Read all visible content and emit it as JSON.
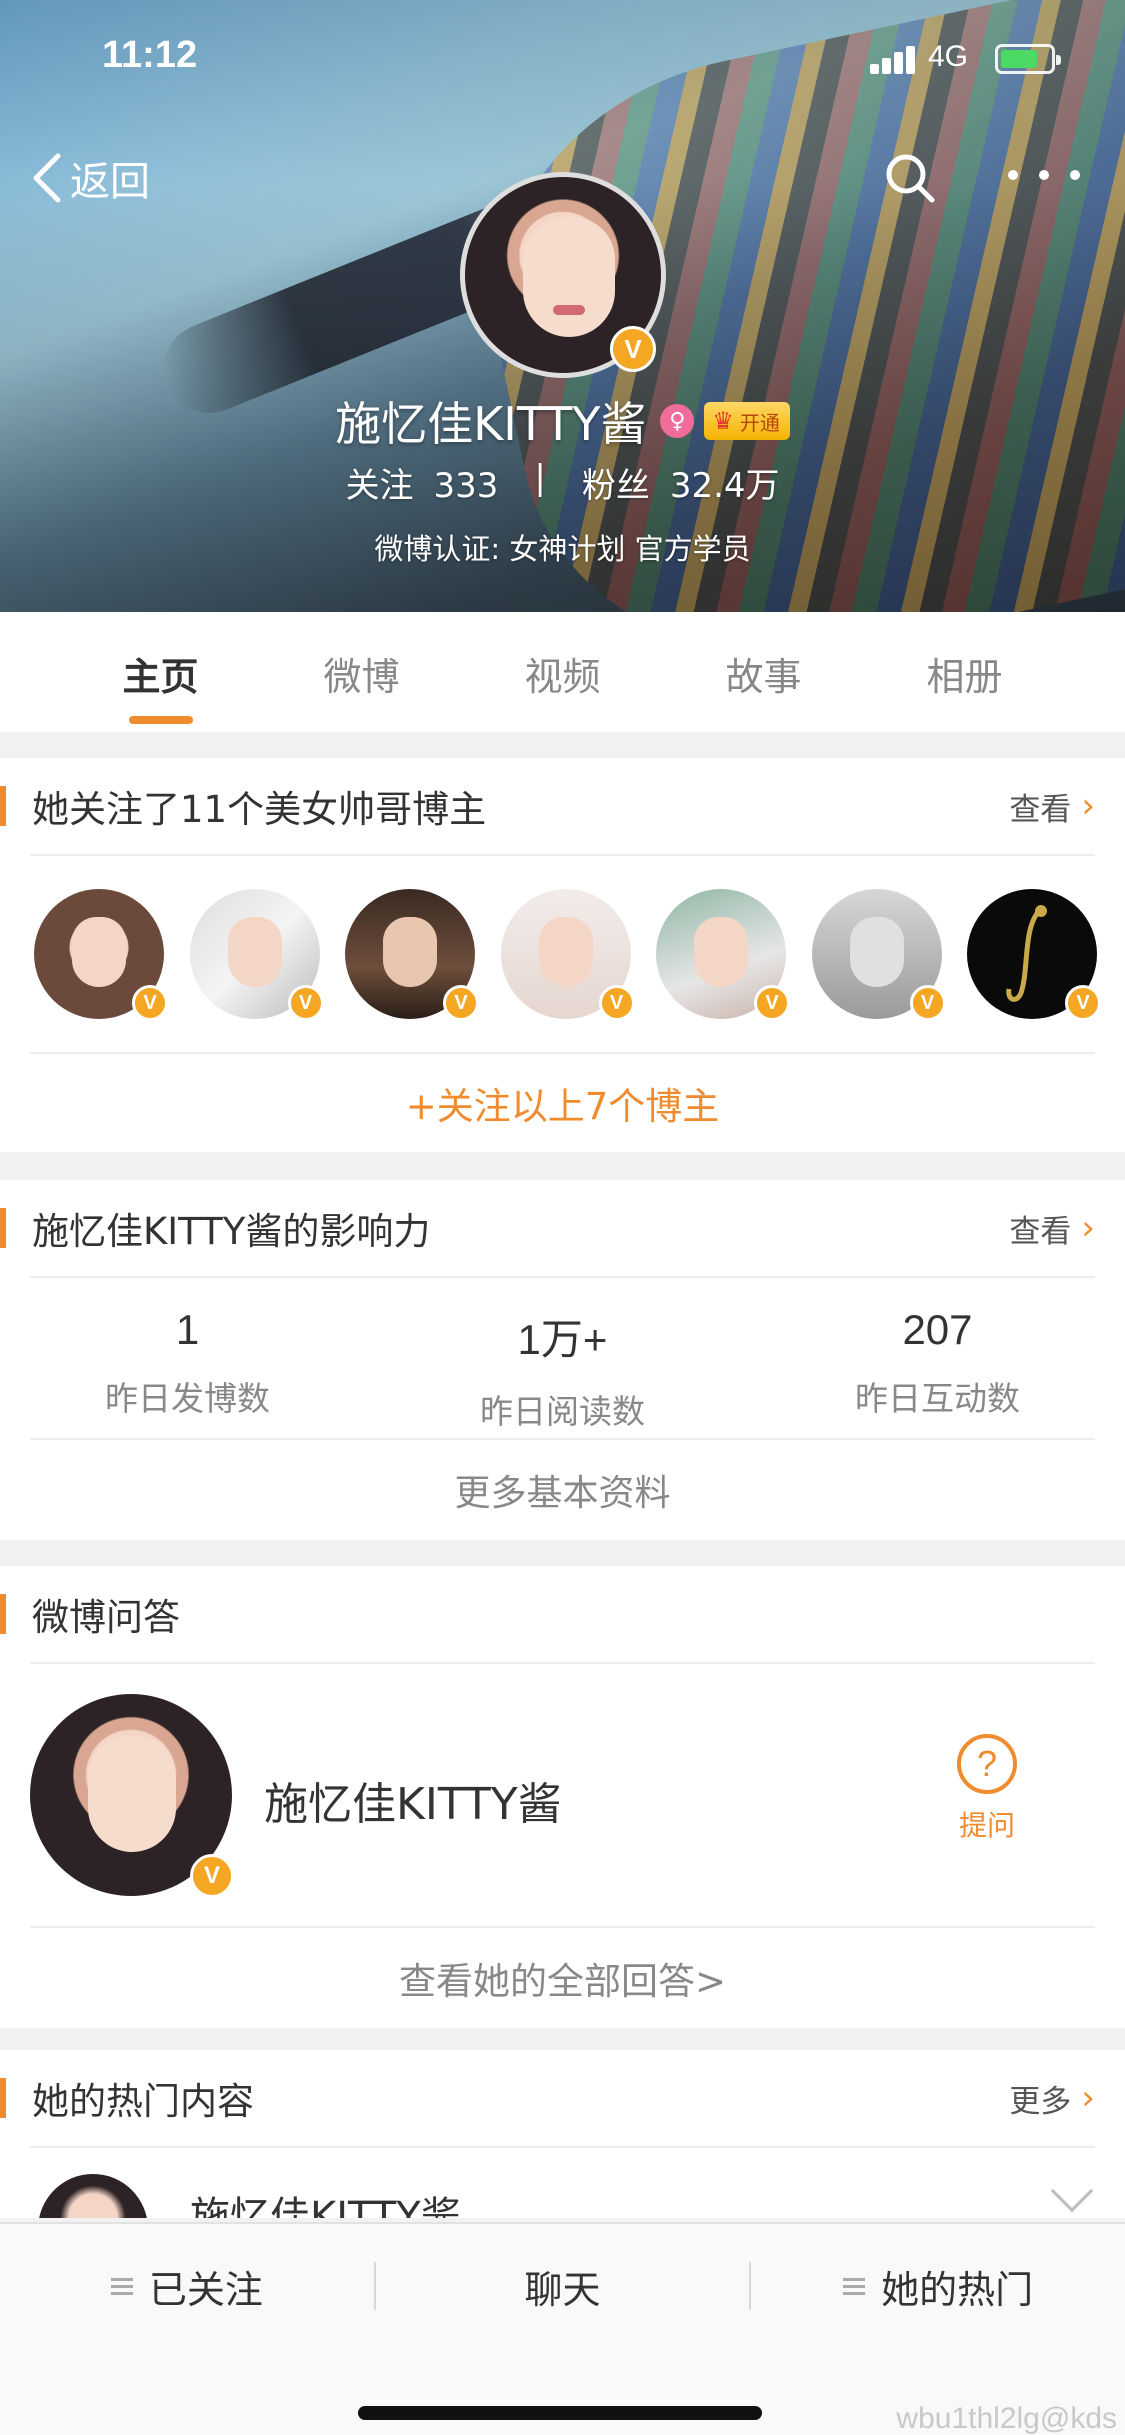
{
  "status_bar": {
    "time": "11:12",
    "network": "4G"
  },
  "header": {
    "back_label": "返回",
    "name": "施忆佳KITTY酱",
    "vip_label": "开通",
    "verify_mark": "V",
    "following_label": "关注",
    "following_count": "333",
    "separator": "|",
    "fans_label": "粉丝",
    "fans_count": "32.4万",
    "verification": "微博认证: 女神计划 官方学员"
  },
  "tabs": [
    {
      "label": "主页",
      "active": true
    },
    {
      "label": "微博",
      "active": false
    },
    {
      "label": "视频",
      "active": false
    },
    {
      "label": "故事",
      "active": false
    },
    {
      "label": "相册",
      "active": false
    }
  ],
  "followed_section": {
    "title": "她关注了11个美女帅哥博主",
    "link": "查看",
    "avatar_badge": "V",
    "avatar_count": 7,
    "follow_all": "+关注以上7个博主"
  },
  "influence_section": {
    "title": "施忆佳KITTY酱的影响力",
    "link": "查看",
    "stats": [
      {
        "value": "1",
        "label": "昨日发博数"
      },
      {
        "value": "1万+",
        "label": "昨日阅读数"
      },
      {
        "value": "207",
        "label": "昨日互动数"
      }
    ],
    "more": "更多基本资料"
  },
  "qa_section": {
    "title": "微博问答",
    "name": "施忆佳KITTY酱",
    "ask_icon": "?",
    "ask_label": "提问",
    "all_answers": "查看她的全部回答>"
  },
  "hot_section": {
    "title": "她的热门内容",
    "link": "更多",
    "preview_name": "施忆佳KITTY酱"
  },
  "bottom_bar": {
    "followed": "已关注",
    "chat": "聊天",
    "hot": "她的热门"
  },
  "watermark": "wbu1thl2lg@kds",
  "colors": {
    "accent": "#f08c2d",
    "verify": "#f5a623",
    "female": "#f06c9b"
  }
}
